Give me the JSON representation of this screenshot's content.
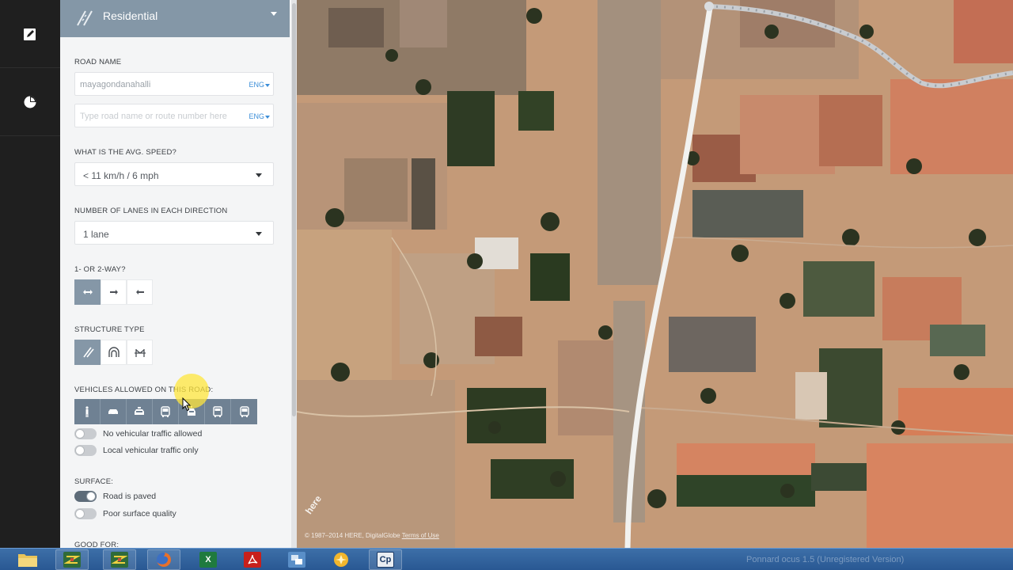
{
  "category": {
    "label": "Residential"
  },
  "road_name": {
    "label": "ROAD NAME",
    "value": "mayagondanahalli",
    "lang": "ENG",
    "alt_placeholder": "Type road name or route number here",
    "alt_lang": "ENG"
  },
  "speed": {
    "label": "WHAT IS THE AVG. SPEED?",
    "value": "< 11 km/h / 6 mph"
  },
  "lanes": {
    "label": "NUMBER OF LANES IN EACH DIRECTION",
    "value": "1 lane"
  },
  "direction": {
    "label": "1- OR 2-WAY?",
    "selected": "two-way"
  },
  "structure": {
    "label": "STRUCTURE TYPE",
    "selected": "road"
  },
  "vehicles": {
    "label": "VEHICLES ALLOWED ON THIS ROAD:",
    "items": [
      "pedestrian",
      "car",
      "taxi",
      "bus",
      "emergency",
      "truck",
      "delivery-van"
    ]
  },
  "toggles": {
    "no_vehicular": {
      "label": "No vehicular traffic allowed",
      "on": false
    },
    "local_only": {
      "label": "Local vehicular traffic only",
      "on": false
    }
  },
  "surface": {
    "label": "SURFACE:",
    "paved": {
      "label": "Road is paved",
      "on": true
    },
    "poor": {
      "label": "Poor surface quality",
      "on": false
    }
  },
  "good_for": {
    "label": "GOOD FOR:"
  },
  "map": {
    "watermark": "here",
    "copyright_prefix": "© 1987–2014 HERE, DigitalGlobe ",
    "copyright_link": "Terms of Use"
  },
  "taskbar": {
    "apps": [
      "file-explorer",
      "app-green-1",
      "app-green-2",
      "firefox",
      "excel",
      "acrobat",
      "network-app",
      "media-app",
      "captivate"
    ],
    "captivate_label": "Cp",
    "window_title": "Ponnard ocus 1.5 (Unregistered Version)"
  },
  "colors": {
    "header": "#8497a7",
    "active_button": "#8597a7",
    "link_blue": "#3c8ed8",
    "taskbar": "#2d5d97"
  }
}
